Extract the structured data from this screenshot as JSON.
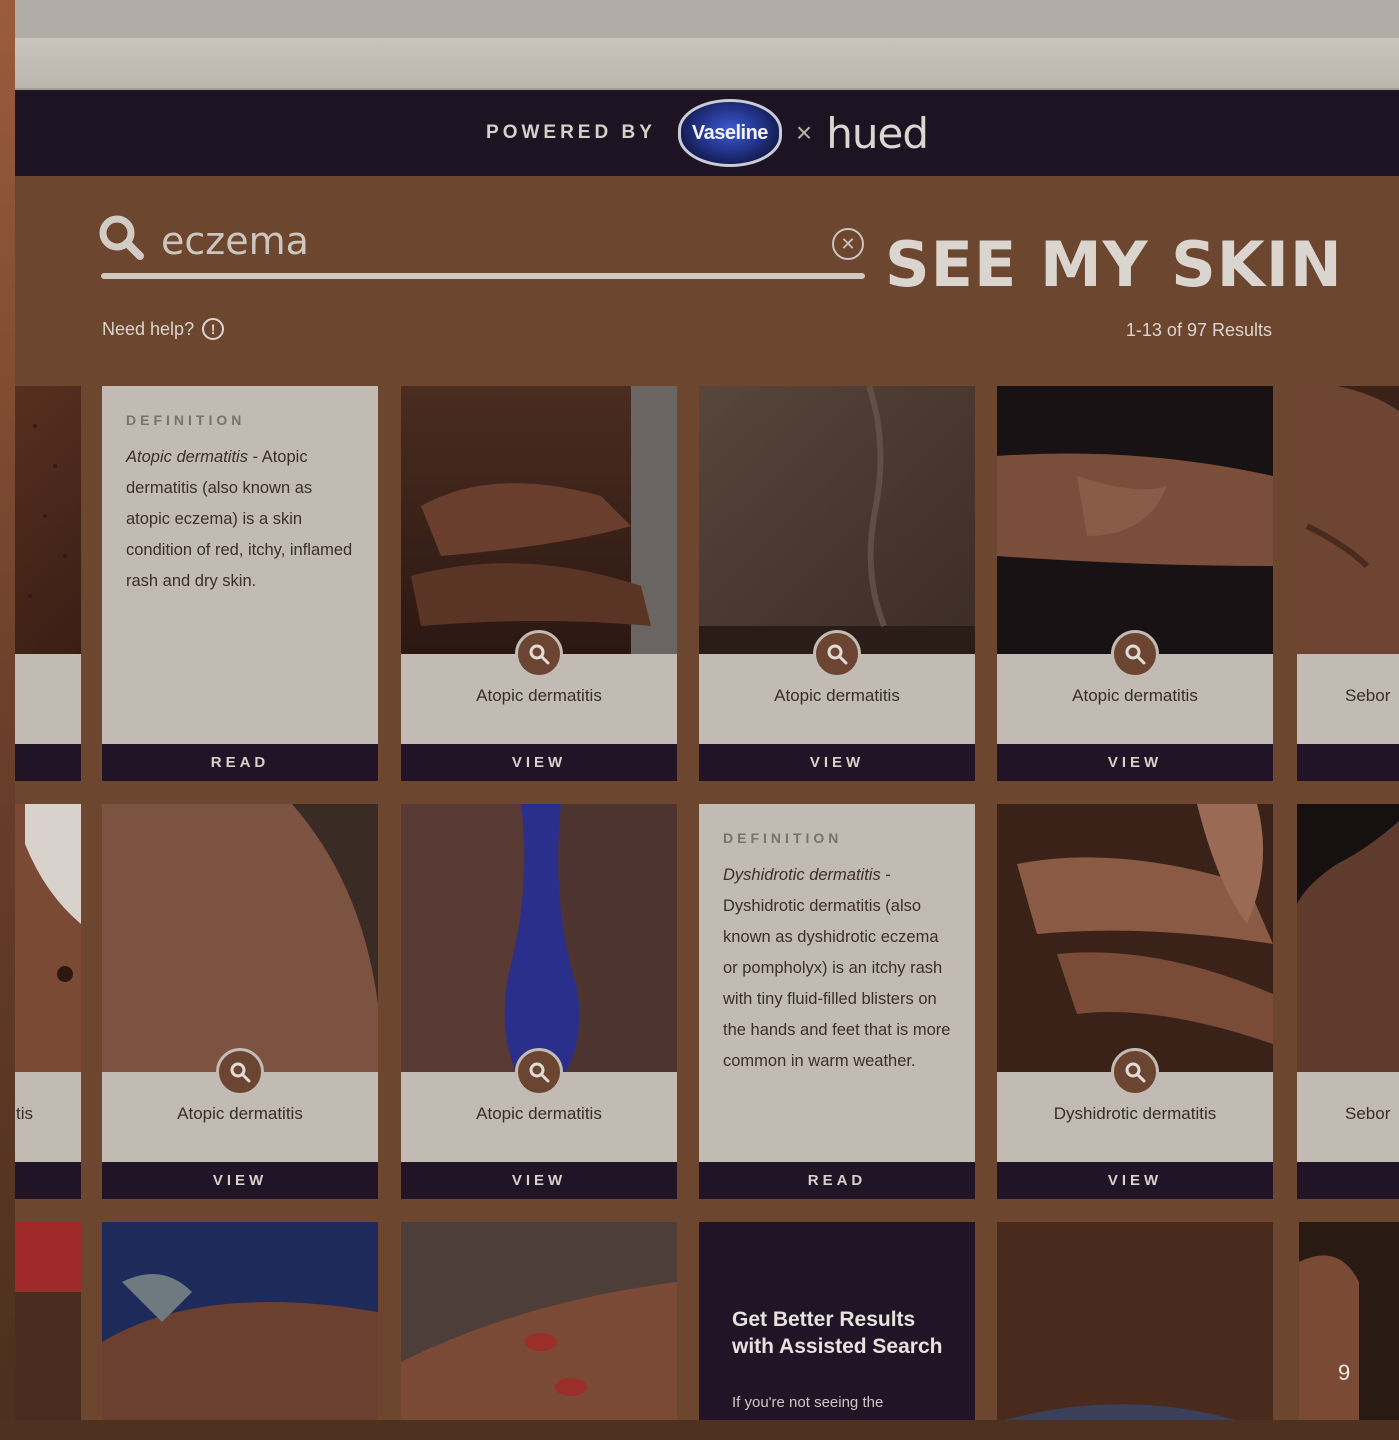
{
  "header": {
    "powered_by": "POWERED BY",
    "vaseline_logo": "Vaseline",
    "times": "×",
    "hued_logo": "hued"
  },
  "search": {
    "value": "eczema",
    "clear_icon": "close-icon"
  },
  "brand_title": "SEE MY SKIN",
  "help": {
    "label": "Need help?",
    "icon_glyph": "!"
  },
  "results_count": "1-13 of 97 Results",
  "cards": {
    "def1": {
      "section": "DEFINITION",
      "term": "Atopic dermatitis",
      "text": " - Atopic dermatitis (also known as atopic eczema) is a skin condition of red, itchy, inflamed rash and dry skin.",
      "action": "READ"
    },
    "c2": {
      "label": "Atopic dermatitis",
      "action": "VIEW"
    },
    "c3": {
      "label": "Atopic dermatitis",
      "action": "VIEW"
    },
    "c4": {
      "label": "Atopic dermatitis",
      "action": "VIEW"
    },
    "c5": {
      "label": "Sebor"
    },
    "c6_partial": {
      "label": "tis"
    },
    "c7": {
      "label": "Atopic dermatitis",
      "action": "VIEW"
    },
    "c8": {
      "label": "Atopic dermatitis",
      "action": "VIEW"
    },
    "def2": {
      "section": "DEFINITION",
      "term": "Dyshidrotic dermatitis",
      "text": " - Dyshidrotic dermatitis (also known as dyshidrotic eczema or pompholyx) is an itchy rash with tiny fluid-filled blisters on the hands and feet that is more common in warm weather.",
      "action": "READ"
    },
    "c10": {
      "label": "Dyshidrotic dermatitis",
      "action": "VIEW"
    },
    "c11": {
      "label": "Sebor"
    }
  },
  "promo": {
    "title": "Get Better Results with Assisted Search",
    "subtitle": "If you're not seeing the"
  },
  "page_number": "9",
  "colors": {
    "background": "#6d4630",
    "navy": "#201426",
    "card": "#c2bbb4",
    "lens": "#6b4531"
  }
}
